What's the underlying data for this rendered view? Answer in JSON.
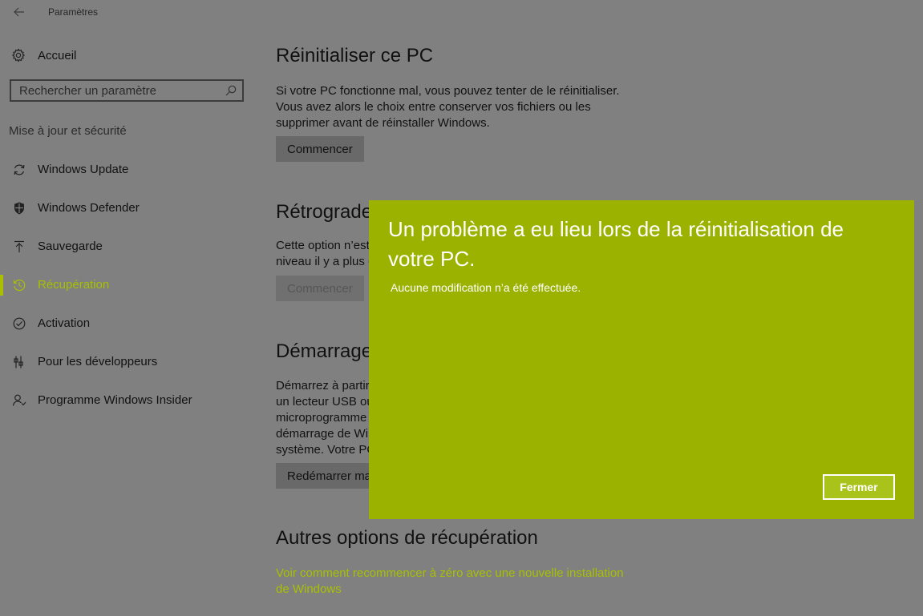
{
  "window": {
    "title": "Paramètres"
  },
  "sidebar": {
    "home_label": "Accueil",
    "search_placeholder": "Rechercher un paramètre",
    "section_heading": "Mise à jour et sécurité",
    "items": [
      {
        "label": "Windows Update",
        "icon": "sync-icon"
      },
      {
        "label": "Windows Defender",
        "icon": "shield-icon"
      },
      {
        "label": "Sauvegarde",
        "icon": "upload-icon"
      },
      {
        "label": "Récupération",
        "icon": "history-icon",
        "active": true
      },
      {
        "label": "Activation",
        "icon": "check-circle-icon"
      },
      {
        "label": "Pour les développeurs",
        "icon": "developer-tools-icon"
      },
      {
        "label": "Programme Windows Insider",
        "icon": "insider-person-icon"
      }
    ]
  },
  "main": {
    "reset": {
      "title": "Réinitialiser ce PC",
      "description": "Si votre PC fonctionne mal, vous pouvez tenter de le réinitialiser. Vous avez alors le choix entre conserver vos fichiers ou les supprimer avant de réinstaller Windows.",
      "button": "Commencer"
    },
    "rollback": {
      "title": "Rétrograde",
      "description_line1": "Cette option n’est",
      "description_line2": "niveau il y a plus c",
      "button": "Commencer"
    },
    "advanced_startup": {
      "title": "Démarrage",
      "lines": [
        "Démarrez à partir",
        "un lecteur USB ou",
        "microprogramme",
        "démarrage de Wi",
        "système. Votre PC"
      ],
      "button": "Redémarrer ma"
    },
    "more_options": {
      "title": "Autres options de récupération",
      "link": "Voir comment recommencer à zéro avec une nouvelle installation de Windows"
    }
  },
  "dialog": {
    "title": "Un problème a eu lieu lors de la réinitialisation de votre PC.",
    "message": "Aucune modification n’a été effectuée.",
    "close_button": "Fermer"
  },
  "colors": {
    "accent": "#a8c000",
    "dialog_background": "#9bb200",
    "dim_background": "#808080"
  }
}
